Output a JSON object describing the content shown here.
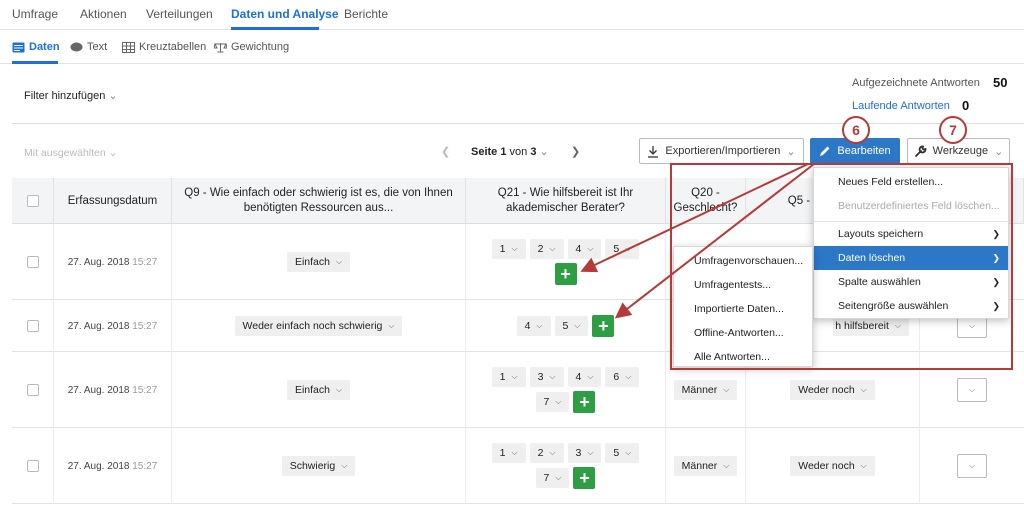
{
  "top_tabs": [
    "Umfrage",
    "Aktionen",
    "Verteilungen",
    "Daten und Analyse",
    "Berichte"
  ],
  "sub_tabs": [
    "Daten",
    "Text",
    "Kreuztabellen",
    "Gewichtung"
  ],
  "filter_label": "Filter hinzufügen",
  "stats": {
    "recorded_label": "Aufgezeichnete Antworten",
    "recorded_value": "50",
    "ongoing_label": "Laufende Antworten",
    "ongoing_value": "0"
  },
  "toolbar": {
    "selected_label": "Mit ausgewählten",
    "page_prefix": "Seite",
    "page_current": "1",
    "page_of": "von",
    "page_total": "3",
    "export_label": "Exportieren/Importieren",
    "edit_label": "Bearbeiten",
    "tools_label": "Werkzeuge"
  },
  "callouts": [
    "6",
    "7"
  ],
  "columns": {
    "date": "Erfassungsdatum",
    "q9": "Q9 - Wie einfach oder schwierig ist es, die von Ihnen benötigten Ressourcen aus...",
    "q21": "Q21 - Wie hilfsbereit ist Ihr akademischer Berater?",
    "q20": "Q20 - Geschlecht?",
    "q5": "Q5 - Wie akadem"
  },
  "rows": [
    {
      "date": "27. Aug. 2018",
      "time": "15:27",
      "q9": "Einfach",
      "q21": [
        "1",
        "2",
        "4",
        "5"
      ],
      "q20": "",
      "q5": ""
    },
    {
      "date": "27. Aug. 2018",
      "time": "15:27",
      "q9": "Weder einfach noch schwierig",
      "q21": [
        "4",
        "5"
      ],
      "q20": "",
      "q5": "h hilfsbereit"
    },
    {
      "date": "27. Aug. 2018",
      "time": "15:27",
      "q9": "Einfach",
      "q21": [
        "1",
        "3",
        "4",
        "6",
        "7"
      ],
      "q20": "Männer",
      "q5": "Weder noch"
    },
    {
      "date": "27. Aug. 2018",
      "time": "15:27",
      "q9": "Schwierig",
      "q21": [
        "1",
        "2",
        "3",
        "5",
        "7"
      ],
      "q20": "Männer",
      "q5": "Weder noch"
    }
  ],
  "tools_menu": [
    "Neues Feld erstellen...",
    "Benutzerdefiniertes Feld löschen...",
    "Layouts speichern",
    "Daten löschen",
    "Spalte auswählen",
    "Seitengröße auswählen"
  ],
  "delete_submenu": [
    "Umfragenvorschauen...",
    "Umfragentests...",
    "Importierte Daten...",
    "Offline-Antworten...",
    "Alle Antworten..."
  ],
  "colors": {
    "accent": "#1e6fd6",
    "primary_button": "#2d77c7",
    "annotation": "#b53a3a",
    "add_green": "#2e9e45"
  }
}
